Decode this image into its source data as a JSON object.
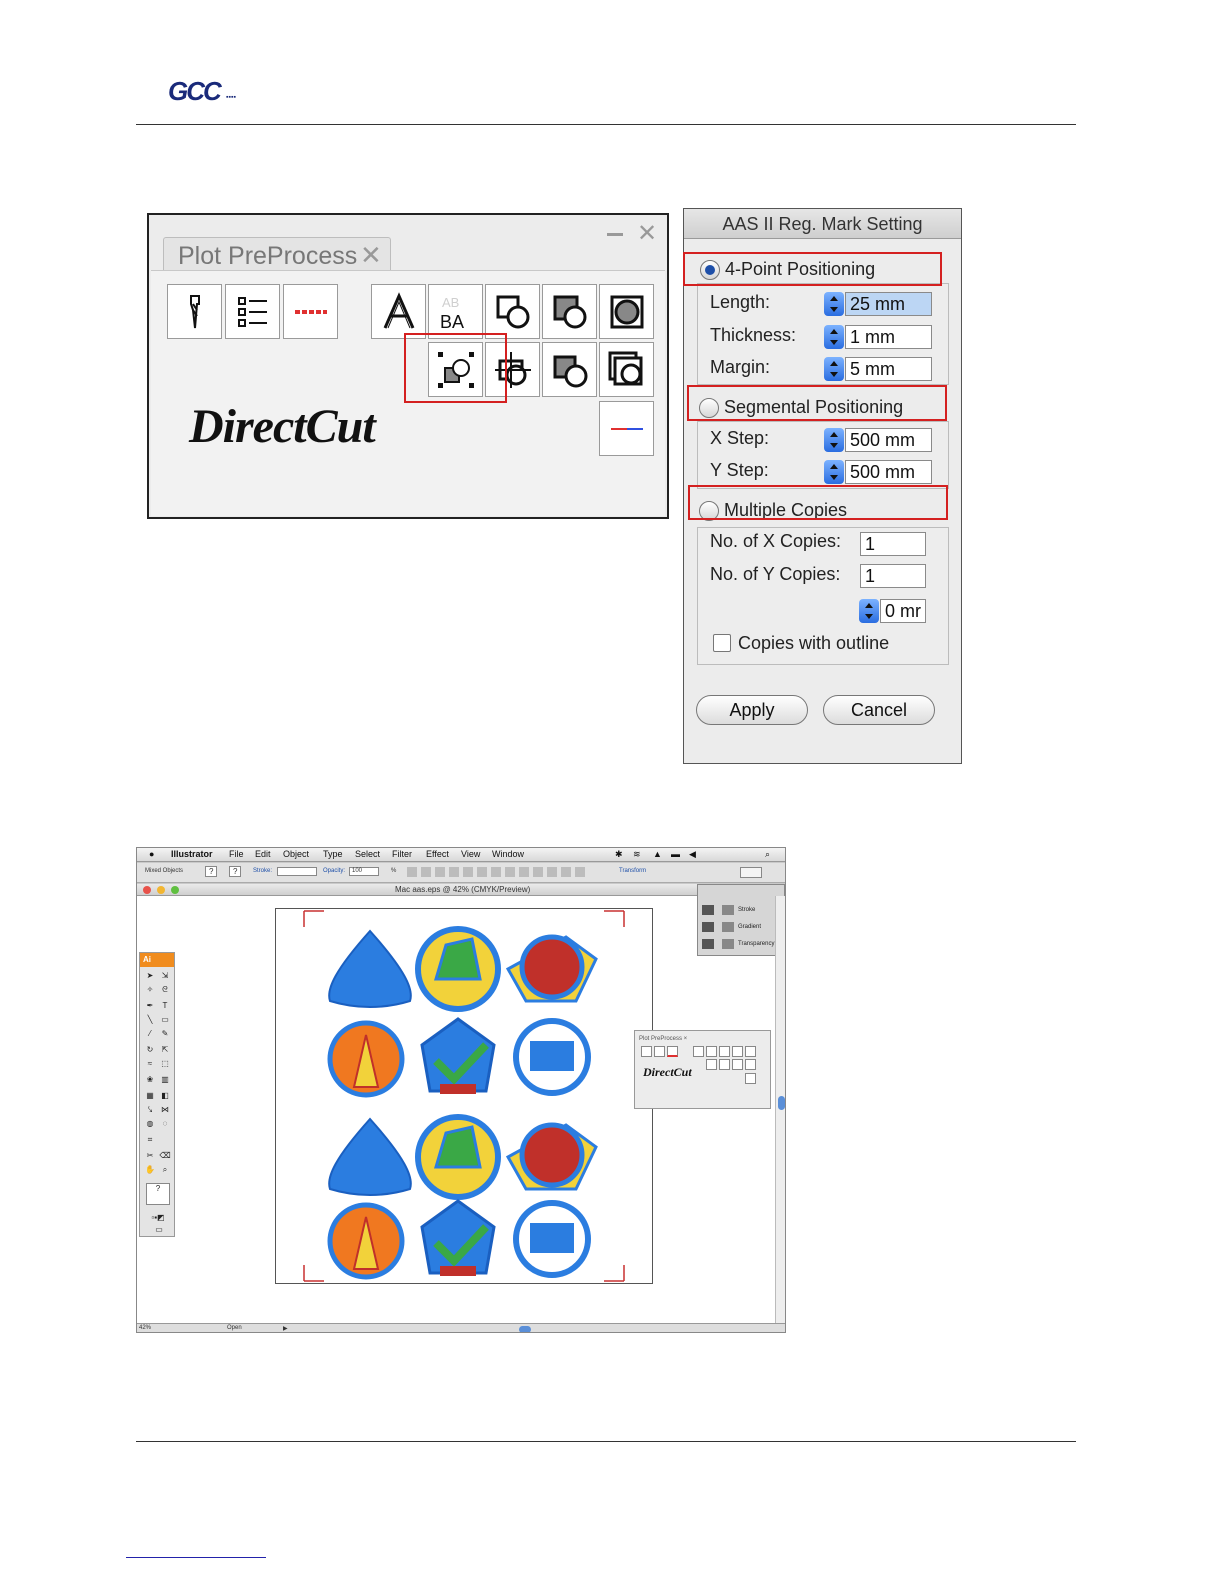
{
  "brand": {
    "logo_text": "GCC"
  },
  "plot_preprocess": {
    "tab_label": "Plot PreProcess",
    "close_glyph": "✕",
    "minimize_glyph": "—",
    "logo_text": "DirectCut",
    "row1_icons": [
      "knife-icon",
      "list-icon",
      "dashed-line-icon"
    ],
    "row1_tools": [
      "outline-text-icon",
      "mirror-text-icon",
      "weld-icon",
      "intersect-icon",
      "shadow-icon"
    ],
    "row2_tools": [
      "reg-mark-icon",
      "crosshair-icon",
      "break-apart-icon",
      "offset-icon"
    ],
    "highlighted_tool": "reg-mark-icon",
    "accent_colors": {
      "red": "#e03030",
      "blue": "#3050e0",
      "highlight": "#d42020"
    },
    "mirror_top": "AB",
    "mirror_bottom": "BA"
  },
  "aas_dialog": {
    "title": "AAS II Reg. Mark Setting",
    "mode_4point": "4-Point Positioning",
    "mode_segmental": "Segmental Positioning",
    "mode_multiple": "Multiple Copies",
    "selected_mode": "4-Point Positioning",
    "length_label": "Length:",
    "length_value": "25 mm",
    "thickness_label": "Thickness:",
    "thickness_value": "1 mm",
    "margin_label": "Margin:",
    "margin_value": "5 mm",
    "xstep_label": "X Step:",
    "xstep_value": "500 mm",
    "ystep_label": "Y Step:",
    "ystep_value": "500 mm",
    "xcopies_label": "No. of X Copies:",
    "xcopies_value": "1",
    "ycopies_label": "No. of Y Copies:",
    "ycopies_value": "1",
    "spacing_value": "0 mr",
    "outline_label": "Copies with outline",
    "apply_label": "Apply",
    "cancel_label": "Cancel"
  },
  "illustrator": {
    "menus": [
      "Illustrator",
      "File",
      "Edit",
      "Object",
      "Type",
      "Select",
      "Filter",
      "Effect",
      "View",
      "Window"
    ],
    "control": {
      "selection": "Mixed Objects",
      "stroke_label": "Stroke:",
      "opacity_label": "Opacity:",
      "opacity_value": "100",
      "percent": "%",
      "transform_label": "Transform",
      "q1": "?",
      "q2": "?"
    },
    "document_title": "Mac aas.eps @ 42% (CMYK/Preview)",
    "toolbox_label": "Ai",
    "dock": [
      "Stroke",
      "Gradient",
      "Transparency"
    ],
    "mini_panel_tab": "Plot PreProcess ×",
    "mini_panel_logo": "DirectCut",
    "status_zoom": "42%",
    "status_text": "Open",
    "status_arrow": "▶",
    "artwork_colors": {
      "blue": "#2b7de0",
      "orange": "#f07820",
      "yellow": "#f2d23a",
      "green": "#3aa846",
      "red": "#c0302a"
    }
  }
}
